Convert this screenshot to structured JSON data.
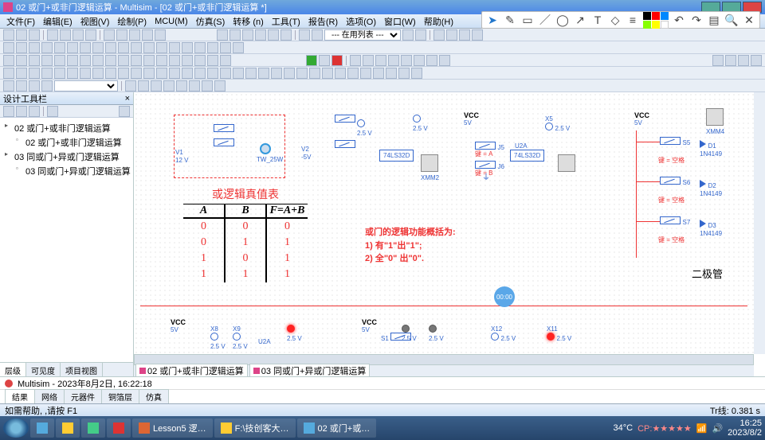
{
  "title": "02 或门+或非门逻辑运算 - Multisim - [02 或门+或非门逻辑运算 *]",
  "menu": {
    "file": "文件(F)",
    "edit": "编辑(E)",
    "view": "视图(V)",
    "place": "绘制(P)",
    "mcu": "MCU(M)",
    "sim": "仿真(S)",
    "transfer": "转移 (n)",
    "tools": "工具(T)",
    "reports": "报告(R)",
    "options": "选项(O)",
    "window": "窗口(W)",
    "help": "帮助(H)"
  },
  "combo_use": "--- 在用列表 ---",
  "sidebar": {
    "title": "设计工具栏",
    "items": [
      {
        "label": "02 或门+或非门逻辑运算"
      },
      {
        "label": "02 或门+或非门逻辑运算",
        "child": true
      },
      {
        "label": "03 同或门+异或门逻辑运算"
      },
      {
        "label": "03 同或门+异或门逻辑运算",
        "child": true
      }
    ],
    "tabs": [
      "层级",
      "可见度",
      "项目视图"
    ]
  },
  "table": {
    "title": "或逻辑真值表",
    "headers": [
      "A",
      "B",
      "F=A+B"
    ],
    "rows": [
      [
        "0",
        "0",
        "0"
      ],
      [
        "0",
        "1",
        "1"
      ],
      [
        "1",
        "0",
        "1"
      ],
      [
        "1",
        "1",
        "1"
      ]
    ]
  },
  "summary": [
    "或门的逻辑功能概括为:",
    "1) 有\"1\"出\"1\";",
    "2) 全\"0\" 出\"0\"."
  ],
  "circuit": {
    "vcc": "VCC",
    "v5": "5V",
    "v25": "2.5 V",
    "u2a": "U2A",
    "ic": "74LS32D",
    "key_a": "键 = A",
    "key_b": "键 = B",
    "key_space": "键 = 空格",
    "v1": "V1",
    "v1v": "12 V",
    "v2": "V2",
    "v2v": "-5V",
    "tw": "TW_25W",
    "x5": "X5",
    "x11": "X11",
    "x12": "X12",
    "x8": "X8",
    "x9": "X9",
    "xmm2": "XMM2",
    "xmm4": "XMM4",
    "j5": "J5",
    "j6": "J6",
    "s1": "S1",
    "s5": "S5",
    "s6": "S6",
    "s7": "S7",
    "d1": "D1",
    "d2": "D2",
    "d3": "D3",
    "diode": "1N4149",
    "side_label": "二极管"
  },
  "doc_tabs": [
    "02 或门+或非门逻辑运算",
    "03 同或门+异或门逻辑运算"
  ],
  "info_line": "Multisim  -  2023年8月2日, 16:22:18",
  "bottom_tabs": [
    "结果",
    "网络",
    "元器件",
    "铜箔层",
    "仿真"
  ],
  "status": "如需帮助, ,请按 F1",
  "status_right": "Tr线: 0.381 s",
  "play_time": "00:00",
  "taskbar": [
    {
      "label": "Lesson5 逻…"
    },
    {
      "label": "F:\\技创客大…"
    },
    {
      "label": "02 或门+或…"
    }
  ],
  "tray": {
    "temp": "34°C",
    "cpu": "CP:★★★★★",
    "time": "16:25",
    "date": "2023/8/2"
  }
}
